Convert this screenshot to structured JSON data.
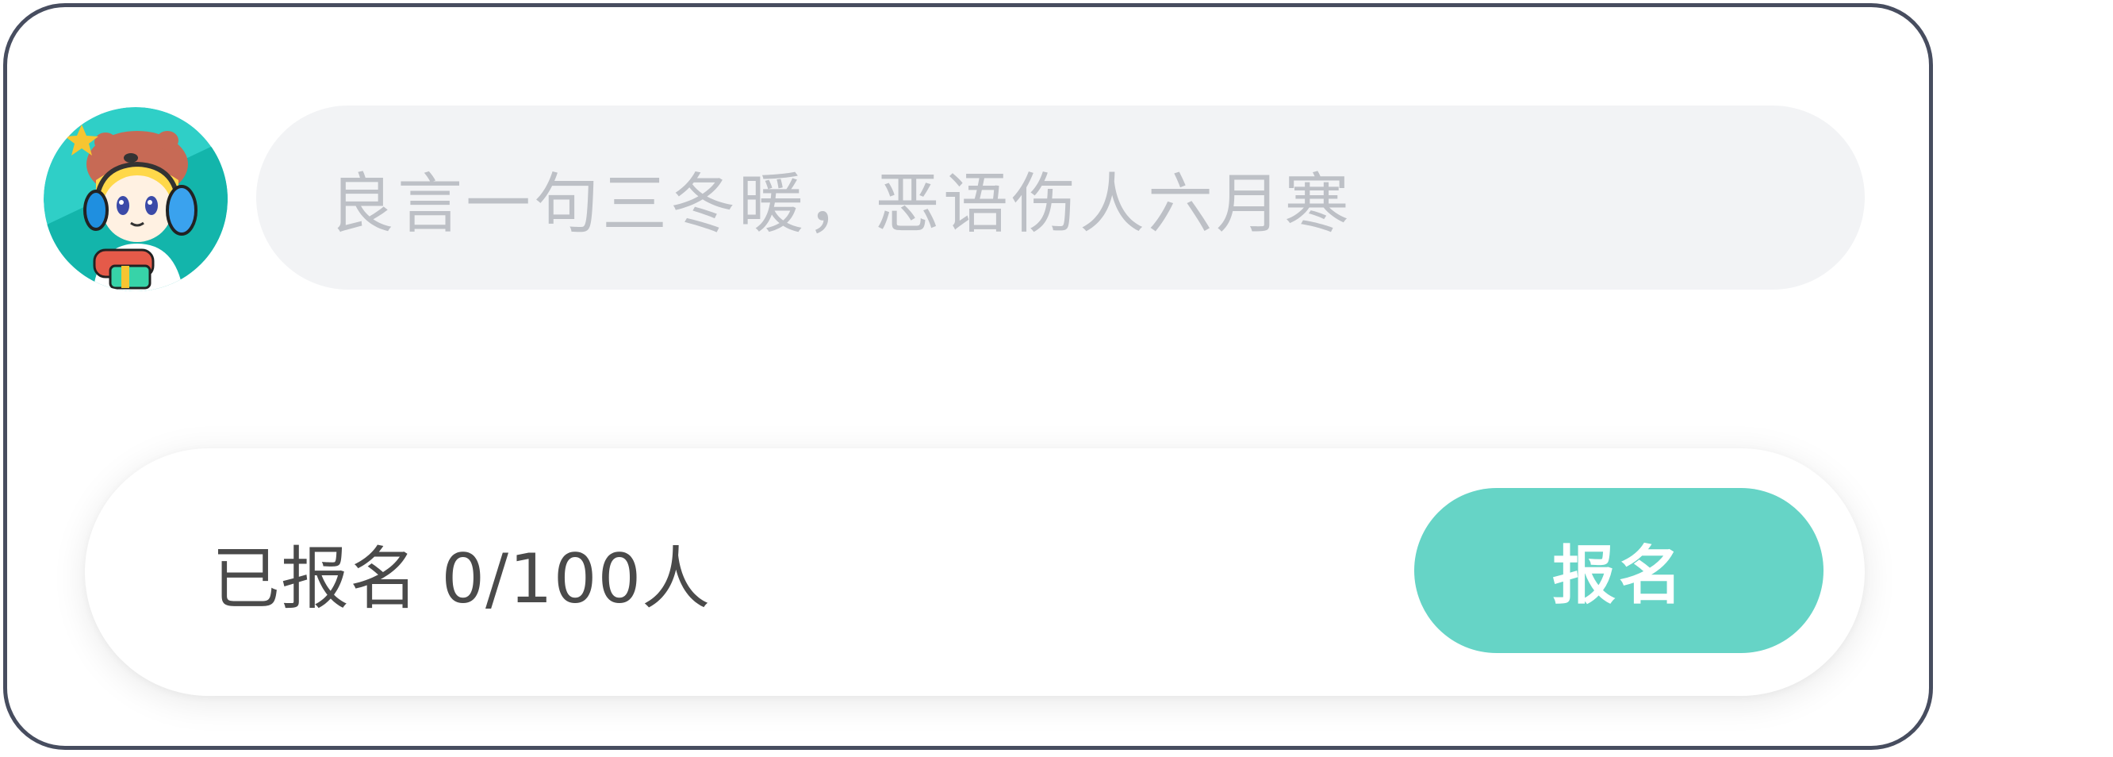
{
  "comment": {
    "avatar_icon": "user-avatar-cartoon-headset",
    "placeholder": "良言一句三冬暖，恶语伤人六月寒"
  },
  "signup": {
    "count_text": "已报名 0/100人",
    "registered": 0,
    "capacity": 100,
    "button_label": "报名"
  },
  "colors": {
    "accent": "#66d4c6",
    "input_bg": "#f2f3f5",
    "placeholder": "#bdc0c6",
    "border": "#474d5f",
    "text": "#4a4a4a"
  }
}
